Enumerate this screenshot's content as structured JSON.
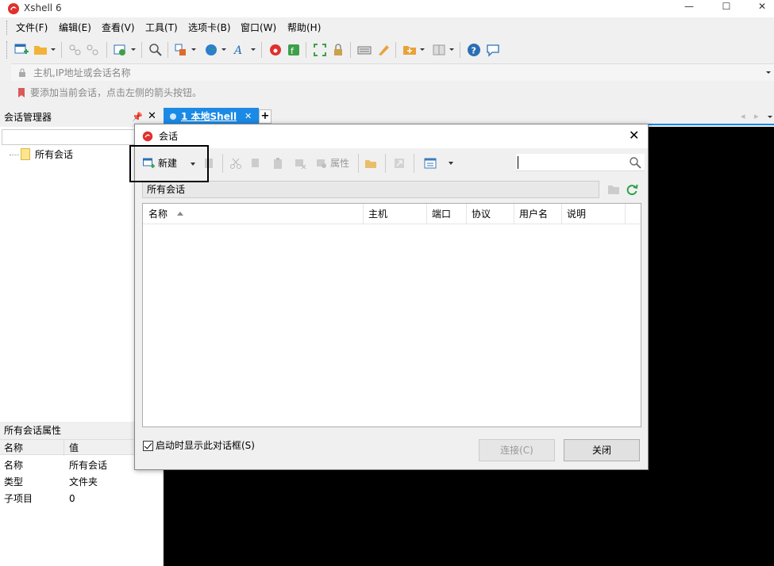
{
  "app": {
    "title": "Xshell 6",
    "window_buttons": {
      "minimize": "—",
      "maximize": "☐",
      "close": "✕"
    }
  },
  "menu": {
    "items": [
      {
        "label": "文件(F)"
      },
      {
        "label": "编辑(E)"
      },
      {
        "label": "查看(V)"
      },
      {
        "label": "工具(T)"
      },
      {
        "label": "选项卡(B)"
      },
      {
        "label": "窗口(W)"
      },
      {
        "label": "帮助(H)"
      }
    ]
  },
  "address_bar": {
    "placeholder": "主机,IP地址或会话名称"
  },
  "hint_bar": {
    "text": "要添加当前会话，点击左侧的箭头按钮。"
  },
  "session_manager": {
    "title": "会话管理器",
    "pin": "ᵖ",
    "close": "✕",
    "tree": [
      {
        "label": "所有会话"
      }
    ],
    "properties": {
      "title": "所有会话属性",
      "headers": {
        "name": "名称",
        "value": "值"
      },
      "rows": [
        {
          "name": "名称",
          "value": "所有会话"
        },
        {
          "name": "类型",
          "value": "文件夹"
        },
        {
          "name": "子项目",
          "value": "0"
        }
      ]
    }
  },
  "tabs": {
    "items": [
      {
        "label": "1 本地Shell",
        "close": "✕"
      }
    ],
    "add": "+",
    "nav_prev": "◂",
    "nav_next": "▸"
  },
  "dialog": {
    "title": "会话",
    "close": "✕",
    "toolbar": {
      "new_label": "新建",
      "properties_label": "属性"
    },
    "path": "所有会话",
    "columns": [
      "名称",
      "主机",
      "端口",
      "协议",
      "用户名",
      "说明"
    ],
    "rows": [],
    "show_on_startup": {
      "label": "启动时显示此对话框(S)",
      "checked": true
    },
    "buttons": {
      "connect": "连接(C)",
      "close": "关闭"
    }
  },
  "colors": {
    "accent": "#1a8ae5",
    "terminal_bg": "#000000"
  }
}
